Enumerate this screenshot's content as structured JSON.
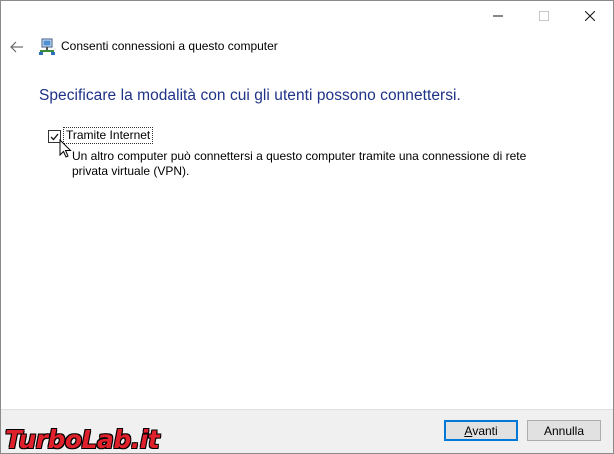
{
  "window": {
    "title": "Consenti connessioni a questo computer"
  },
  "content": {
    "heading": "Specificare la modalità con cui gli utenti possono connettersi.",
    "option": {
      "label": "Tramite Internet",
      "checked": true,
      "description": "Un altro computer può connettersi a questo computer tramite una connessione di rete privata virtuale (VPN)."
    }
  },
  "buttons": {
    "next": "Avanti",
    "next_accel": "A",
    "next_rest": "vanti",
    "cancel": "Annulla"
  },
  "watermark": {
    "text": "TurboLab.it"
  },
  "colors": {
    "heading": "#1e3287",
    "primary_button_border": "#0078d7",
    "watermark": "#e0202a"
  },
  "icons": [
    "minimize-icon",
    "maximize-icon",
    "close-icon",
    "back-arrow-icon",
    "network-computer-icon",
    "checkmark-icon",
    "mouse-cursor-icon"
  ]
}
